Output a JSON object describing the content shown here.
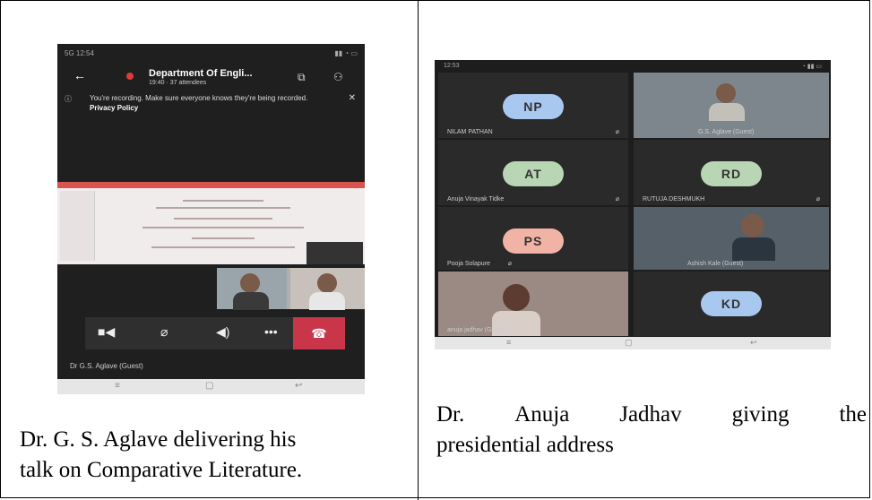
{
  "left": {
    "caption_line1": "Dr. G. S. Aglave delivering his",
    "caption_line2": "talk on Comparative Literature.",
    "phone": {
      "status_left": "5G 12:54",
      "status_right": "",
      "back_icon": "back-arrow-icon",
      "meeting_title": "Department Of Engli...",
      "meeting_subtitle": "19:40 · 37 attendees",
      "recording_notice": "You're recording. Make sure everyone knows they're being recorded.",
      "privacy_link": "Privacy Policy",
      "participant_name": "Dr G.S. Aglave (Guest)"
    }
  },
  "right": {
    "caption_words": [
      "Dr.",
      "Anuja",
      "Jadhav",
      "giving",
      "the"
    ],
    "caption_line2": "presidential address",
    "phone": {
      "status_left": "12:53",
      "status_right": "",
      "tiles": [
        {
          "initials": "NP",
          "name": "NILAM PATHAN",
          "color": "#a9c8ef"
        },
        {
          "initials": "",
          "name": "G.S. Aglave (Guest)",
          "color": ""
        },
        {
          "initials": "AT",
          "name": "Anuja Vinayak Tidke",
          "color": "#b9d6b4"
        },
        {
          "initials": "RD",
          "name": "RUTUJA DESHMUKH",
          "color": "#b9d6b4"
        },
        {
          "initials": "PS",
          "name": "Pooja Solapure",
          "color": "#f2b3a7"
        },
        {
          "initials": "",
          "name": "Ashish Kale (Guest)",
          "color": ""
        },
        {
          "initials": "",
          "name": "anuja jadhav (Guest)",
          "color": ""
        },
        {
          "initials": "KD",
          "name": "",
          "color": "#a9c8ef"
        }
      ]
    }
  }
}
